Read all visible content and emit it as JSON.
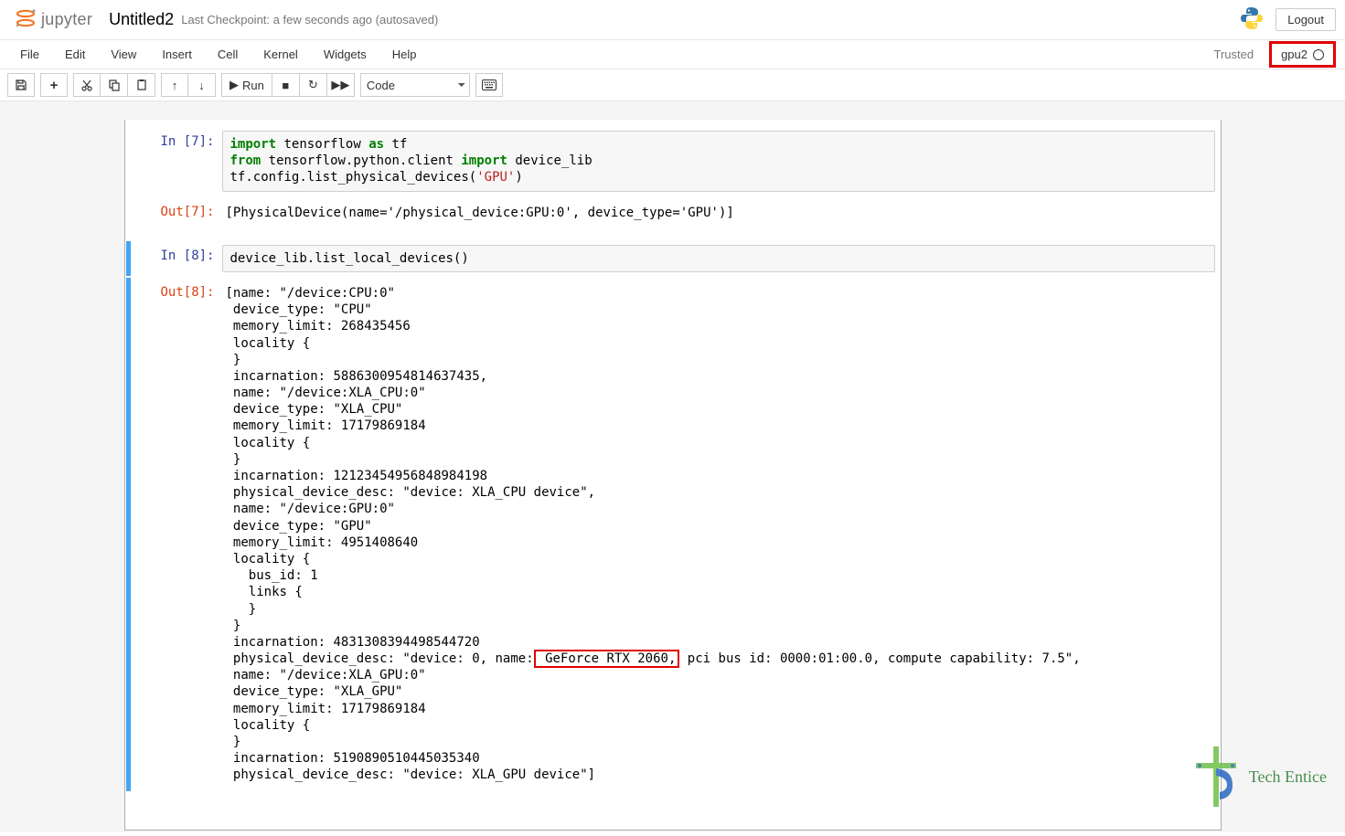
{
  "header": {
    "logo_text": "jupyter",
    "notebook_name": "Untitled2",
    "checkpoint": "Last Checkpoint: a few seconds ago  (autosaved)",
    "logout": "Logout"
  },
  "menubar": {
    "items": [
      "File",
      "Edit",
      "View",
      "Insert",
      "Cell",
      "Kernel",
      "Widgets",
      "Help"
    ],
    "trusted": "Trusted",
    "kernel_name": "gpu2"
  },
  "toolbar": {
    "run_label": "Run",
    "cell_type": "Code"
  },
  "cells": [
    {
      "in_prompt": "In [7]:",
      "out_prompt": "Out[7]:",
      "code": {
        "l1_kw1": "import",
        "l1_rest": " tensorflow ",
        "l1_kw2": "as",
        "l1_rest2": " tf",
        "l2_kw1": "from",
        "l2_rest": " tensorflow.python.client ",
        "l2_kw2": "import",
        "l2_rest2": " device_lib",
        "l3_a": "tf.config.list_physical_devices(",
        "l3_str": "'GPU'",
        "l3_b": ")"
      },
      "output": "[PhysicalDevice(name='/physical_device:GPU:0', device_type='GPU')]"
    },
    {
      "in_prompt": "In [8]:",
      "out_prompt": "Out[8]:",
      "code_plain": "device_lib.list_local_devices()",
      "output_pre": "[name: \"/device:CPU:0\"\n device_type: \"CPU\"\n memory_limit: 268435456\n locality {\n }\n incarnation: 5886300954814637435,\n name: \"/device:XLA_CPU:0\"\n device_type: \"XLA_CPU\"\n memory_limit: 17179869184\n locality {\n }\n incarnation: 12123454956848984198\n physical_device_desc: \"device: XLA_CPU device\",\n name: \"/device:GPU:0\"\n device_type: \"GPU\"\n memory_limit: 4951408640\n locality {\n   bus_id: 1\n   links {\n   }\n }\n incarnation: 4831308394498544720\n physical_device_desc: \"device: 0, name:",
      "output_hl": " GeForce RTX 2060,",
      "output_post": " pci bus id: 0000:01:00.0, compute capability: 7.5\",\n name: \"/device:XLA_GPU:0\"\n device_type: \"XLA_GPU\"\n memory_limit: 17179869184\n locality {\n }\n incarnation: 5190890510445035340\n physical_device_desc: \"device: XLA_GPU device\"]"
    }
  ],
  "watermark": "Tech Entice"
}
